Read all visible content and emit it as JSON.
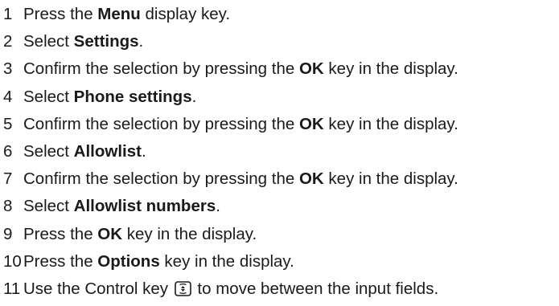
{
  "steps": [
    {
      "num": "1",
      "pre": "Press the ",
      "bold": "Menu",
      "post": " display key."
    },
    {
      "num": "2",
      "pre": "Select ",
      "bold": "Settings",
      "post": "."
    },
    {
      "num": "3",
      "pre": "Confirm the selection by pressing the ",
      "bold": "OK",
      "post": " key in the display."
    },
    {
      "num": "4",
      "pre": "Select ",
      "bold": "Phone settings",
      "post": "."
    },
    {
      "num": "5",
      "pre": "Confirm the selection by pressing the ",
      "bold": "OK",
      "post": " key in the display."
    },
    {
      "num": "6",
      "pre": "Select ",
      "bold": "Allowlist",
      "post": "."
    },
    {
      "num": "7",
      "pre": "Confirm the selection by pressing the ",
      "bold": "OK",
      "post": " key in the display."
    },
    {
      "num": "8",
      "pre": "Select ",
      "bold": "Allowlist numbers",
      "post": "."
    },
    {
      "num": "9",
      "pre": "Press the ",
      "bold": "OK",
      "post": " key in the display."
    },
    {
      "num": "10",
      "pre": "Press the ",
      "bold": "Options",
      "post": " key in the display."
    },
    {
      "num": "11",
      "pre": "Use the Control key ",
      "icon": "control-key-icon",
      "post": " to move between the input fields."
    }
  ]
}
